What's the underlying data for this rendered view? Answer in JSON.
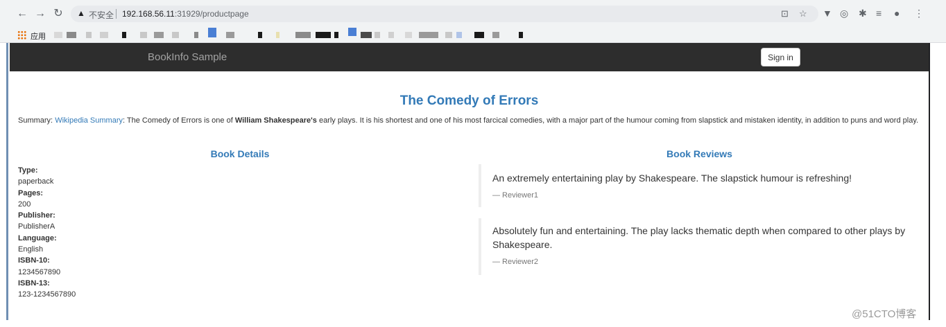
{
  "browser": {
    "security_text": "不安全",
    "url_host": "192.168.56.11",
    "url_rest": ":31929/productpage",
    "apps_label": "应用"
  },
  "navbar": {
    "brand": "BookInfo Sample",
    "signin_label": "Sign in"
  },
  "product": {
    "title": "The Comedy of Errors",
    "summary_prefix": "Summary: ",
    "summary_link": "Wikipedia Summary",
    "summary_text1": ": The Comedy of Errors is one of ",
    "summary_author": "William Shakespeare's",
    "summary_text2": " early plays. It is his shortest and one of his most farcical comedies, with a major part of the humour coming from slapstick and mistaken identity, in addition to puns and word play."
  },
  "details": {
    "heading": "Book Details",
    "items": [
      {
        "label": "Type:",
        "value": "paperback"
      },
      {
        "label": "Pages:",
        "value": "200"
      },
      {
        "label": "Publisher:",
        "value": "PublisherA"
      },
      {
        "label": "Language:",
        "value": "English"
      },
      {
        "label": "ISBN-10:",
        "value": "1234567890"
      },
      {
        "label": "ISBN-13:",
        "value": "123-1234567890"
      }
    ]
  },
  "reviews": {
    "heading": "Book Reviews",
    "items": [
      {
        "text": "An extremely entertaining play by Shakespeare. The slapstick humour is refreshing!",
        "reviewer": "— Reviewer1"
      },
      {
        "text": "Absolutely fun and entertaining. The play lacks thematic depth when compared to other plays by Shakespeare.",
        "reviewer": "— Reviewer2"
      }
    ]
  },
  "watermark": "@51CTO博客"
}
